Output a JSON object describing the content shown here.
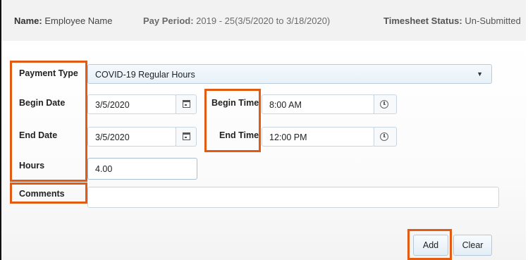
{
  "header": {
    "name_label": "Name:",
    "name_value": "Employee Name",
    "pay_period_label": "Pay Period:",
    "pay_period_value": "2019 - 25(3/5/2020 to 3/18/2020)",
    "status_label": "Timesheet Status:",
    "status_value": "Un-Submitted"
  },
  "form": {
    "payment_type_label": "Payment Type",
    "payment_type_value": "COVID-19 Regular Hours",
    "begin_date_label": "Begin Date",
    "begin_date_value": "3/5/2020",
    "end_date_label": "End Date",
    "end_date_value": "3/5/2020",
    "begin_time_label": "Begin Time",
    "begin_time_value": "8:00 AM",
    "end_time_label": "End Time",
    "end_time_value": "12:00 PM",
    "hours_label": "Hours",
    "hours_value": "4.00",
    "comments_label": "Comments",
    "comments_value": ""
  },
  "icons": {
    "dropdown": "chevron-down-icon",
    "calendar": "calendar-icon",
    "clock": "clock-icon"
  },
  "buttons": {
    "add_label": "Add",
    "clear_label": "Clear"
  },
  "colors": {
    "highlight": "#e35b12",
    "header_bg": "#f2f2f2"
  }
}
